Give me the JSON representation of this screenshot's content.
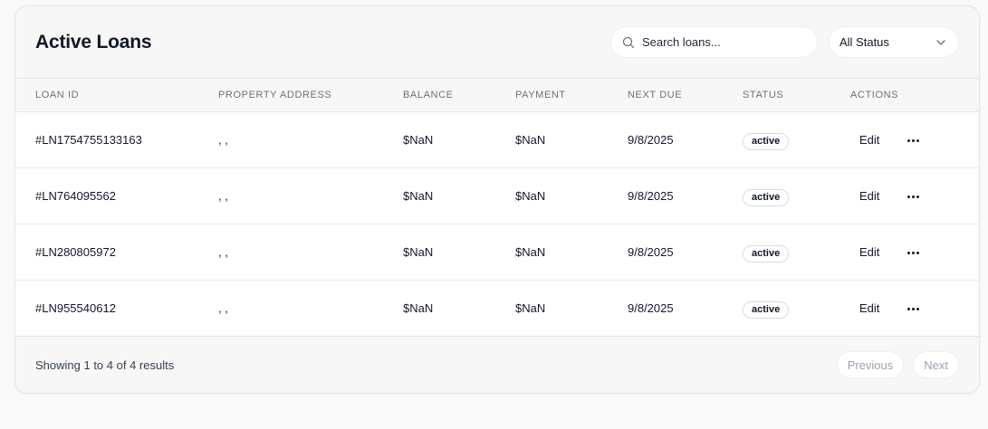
{
  "card": {
    "title": "Active Loans",
    "search_placeholder": "Search loans...",
    "status_filter": {
      "selected": "All Status"
    }
  },
  "table": {
    "columns": [
      "LOAN ID",
      "PROPERTY ADDRESS",
      "BALANCE",
      "PAYMENT",
      "NEXT DUE",
      "STATUS",
      "ACTIONS"
    ],
    "rows": [
      {
        "loan_id": "#LN1754755133163",
        "address": ", ,",
        "balance": "$NaN",
        "payment": "$NaN",
        "next_due": "9/8/2025",
        "status": "active",
        "edit": "Edit"
      },
      {
        "loan_id": "#LN764095562",
        "address": ", ,",
        "balance": "$NaN",
        "payment": "$NaN",
        "next_due": "9/8/2025",
        "status": "active",
        "edit": "Edit"
      },
      {
        "loan_id": "#LN280805972",
        "address": ", ,",
        "balance": "$NaN",
        "payment": "$NaN",
        "next_due": "9/8/2025",
        "status": "active",
        "edit": "Edit"
      },
      {
        "loan_id": "#LN955540612",
        "address": ", ,",
        "balance": "$NaN",
        "payment": "$NaN",
        "next_due": "9/8/2025",
        "status": "active",
        "edit": "Edit"
      }
    ]
  },
  "footer": {
    "showing_text": "Showing 1 to 4 of 4 results",
    "previous_label": "Previous",
    "next_label": "Next"
  },
  "icons": {
    "search": "search-icon",
    "chevron": "chevron-down-icon",
    "more": "more-horizontal-icon"
  }
}
